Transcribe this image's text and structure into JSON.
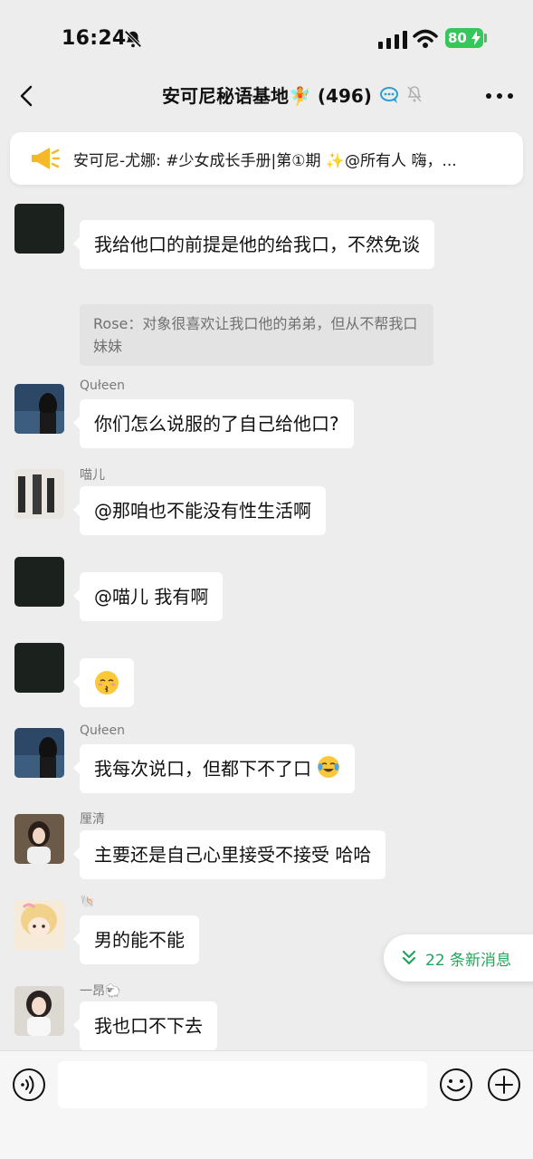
{
  "status_bar": {
    "time": "16:24",
    "battery": "80"
  },
  "header": {
    "title": "安可尼秘语基地🧚 (496)",
    "back_icon": "chevron-left-icon",
    "more_icon": "more-icon"
  },
  "pinned": {
    "text": "安可尼-尤娜: #少女成长手册|第①期 ✨@所有人  嗨，..."
  },
  "messages": [
    {
      "sender": "",
      "text": "我给他口的前提是他的给我口，不然免谈",
      "quote": "Rose：对象很喜欢让我口他的弟弟，但从不帮我口妹妹"
    },
    {
      "sender": "Qułeen",
      "text": "你们怎么说服的了自己给他口?"
    },
    {
      "sender": "喵儿",
      "text": "@那咱也不能没有性生活啊"
    },
    {
      "sender": "",
      "text": "@喵儿 我有啊"
    },
    {
      "sender": "",
      "text": ""
    },
    {
      "sender": "Qułeen",
      "text": "我每次说口，但都下不了口"
    },
    {
      "sender": "厘清",
      "text": "主要还是自己心里接受不接受 哈哈"
    },
    {
      "sender": "🐚",
      "text": "男的能不能"
    },
    {
      "sender": "一昂🐑",
      "text": "我也口不下去"
    }
  ],
  "new_messages": {
    "label": "22 条新消息"
  },
  "input": {
    "placeholder": ""
  },
  "colors": {
    "accent_green": "#20a65a",
    "battery_green": "#34c759",
    "background": "#ededed"
  }
}
